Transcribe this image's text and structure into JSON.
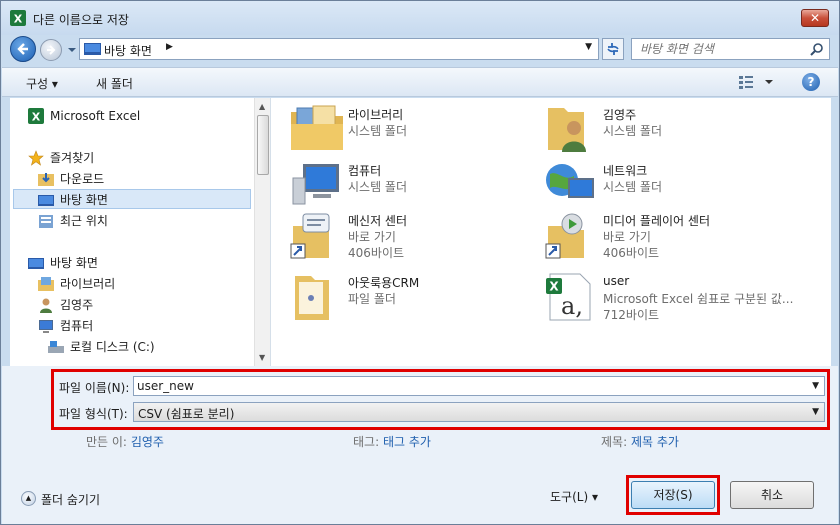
{
  "window": {
    "title": "다른 이름으로 저장",
    "close_label": "✕"
  },
  "address_bar": {
    "crumb": "바탕 화면",
    "search_placeholder": "바탕 화면 검색"
  },
  "toolbar": {
    "organize_label": "구성 ▾",
    "new_folder_label": "새 폴더",
    "help_label": "?"
  },
  "nav": {
    "items": [
      {
        "label": "Microsoft Excel",
        "icon": "excel-icon"
      },
      {
        "label": "즐겨찾기",
        "icon": "star-icon"
      },
      {
        "label": "다운로드",
        "icon": "downloads-folder-icon"
      },
      {
        "label": "바탕 화면",
        "icon": "desktop-icon",
        "selected": true
      },
      {
        "label": "최근 위치",
        "icon": "recent-places-icon"
      },
      {
        "label": "바탕 화면",
        "icon": "desktop-icon"
      },
      {
        "label": "라이브러리",
        "icon": "library-icon"
      },
      {
        "label": "김영주",
        "icon": "user-icon"
      },
      {
        "label": "컴퓨터",
        "icon": "computer-icon"
      },
      {
        "label": "로컬 디스크 (C:)",
        "icon": "drive-icon"
      }
    ]
  },
  "files": [
    {
      "name": "라이브러리",
      "line1": "시스템 폴더",
      "line2": "",
      "icon": "library-folder-icon"
    },
    {
      "name": "김영주",
      "line1": "시스템 폴더",
      "line2": "",
      "icon": "user-folder-icon"
    },
    {
      "name": "컴퓨터",
      "line1": "시스템 폴더",
      "line2": "",
      "icon": "computer-icon"
    },
    {
      "name": "네트워크",
      "line1": "시스템 폴더",
      "line2": "",
      "icon": "network-icon"
    },
    {
      "name": "메신저 센터",
      "line1": "바로 가기",
      "line2": "406바이트",
      "icon": "messenger-shortcut-icon"
    },
    {
      "name": "미디어 플레이어 센터",
      "line1": "바로 가기",
      "line2": "406바이트",
      "icon": "media-player-shortcut-icon"
    },
    {
      "name": "아웃룩용CRM",
      "line1": "파일 폴더",
      "line2": "",
      "icon": "folder-icon"
    },
    {
      "name": "user",
      "line1": "Microsoft Excel 쉼표로 구분된 값...",
      "line2": "712바이트",
      "icon": "csv-file-icon"
    }
  ],
  "form": {
    "filename_label": "파일 이름(N):",
    "filename_value": "user_new",
    "filetype_label": "파일 형식(T):",
    "filetype_value": "CSV (쉼표로 분리)",
    "author_label": "만든 이:",
    "author_value": "김영주",
    "tags_label": "태그:",
    "tags_value": "태그 추가",
    "title_label": "제목:",
    "title_value": "제목 추가"
  },
  "footer": {
    "hide_folders_label": "폴더 숨기기",
    "tools_label": "도구(L)  ▾",
    "save_label": "저장(S)",
    "cancel_label": "취소"
  },
  "colors": {
    "highlight_border": "#e00000",
    "link": "#1f5fae"
  }
}
